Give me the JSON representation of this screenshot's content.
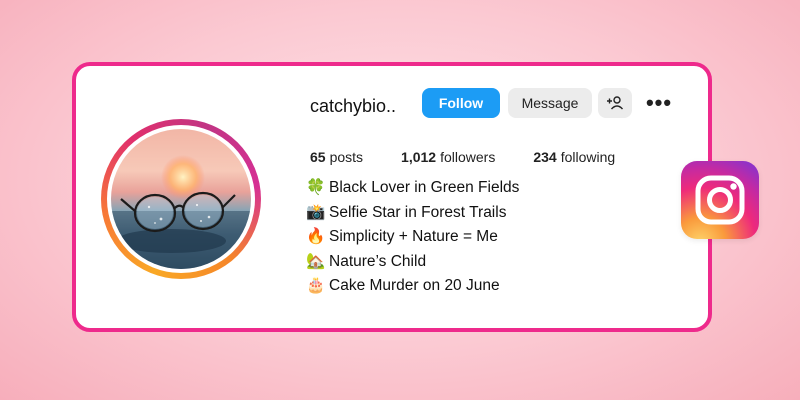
{
  "profile": {
    "username": "catchybio..",
    "buttons": {
      "follow": "Follow",
      "message": "Message",
      "add_user_icon": "person-plus-icon",
      "more_icon": "more-dots-icon",
      "more_glyph": "•••"
    },
    "stats": [
      {
        "value": "65",
        "label": "posts"
      },
      {
        "value": "1,012",
        "label": "followers"
      },
      {
        "value": "234",
        "label": "following"
      }
    ],
    "bio": [
      {
        "icon": "🍀",
        "icon_name": "four-leaf-clover-icon",
        "text": "Black Lover in Green Fields"
      },
      {
        "icon": "📸",
        "icon_name": "camera-flash-icon",
        "text": "Selfie Star in Forest Trails"
      },
      {
        "icon": "🔥",
        "icon_name": "fire-icon",
        "text": "Simplicity + Nature = Me"
      },
      {
        "icon": "🏡",
        "icon_name": "house-garden-icon",
        "text": "Nature’s Child"
      },
      {
        "icon": "🎂",
        "icon_name": "birthday-cake-icon",
        "text": "Cake Murder on 20 June"
      }
    ]
  },
  "colors": {
    "card_border": "#ee2a8c",
    "follow_button": "#1c9cf5",
    "secondary_button": "#ececec"
  },
  "brand_logo": "instagram-logo-icon"
}
